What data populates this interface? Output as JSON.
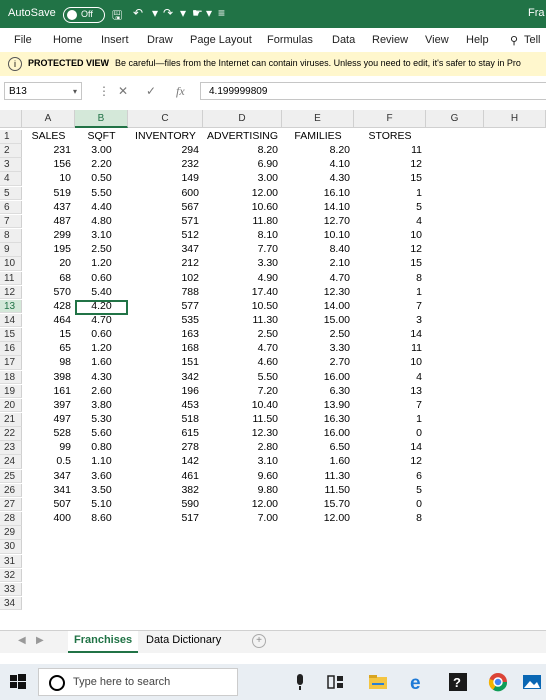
{
  "titlebar": {
    "autosave_label": "AutoSave",
    "autosave_state": "Off",
    "right_text": "Fra"
  },
  "ribbon": {
    "tabs": [
      "File",
      "Home",
      "Insert",
      "Draw",
      "Page Layout",
      "Formulas",
      "Data",
      "Review",
      "View",
      "Help",
      "Tell"
    ]
  },
  "protected": {
    "label": "PROTECTED VIEW",
    "message": "Be careful—files from the Internet can contain viruses. Unless you need to edit, it's safer to stay in Pro"
  },
  "formula_bar": {
    "name_box": "B13",
    "fx": "fx",
    "value": "4.199999809"
  },
  "columns": [
    "A",
    "B",
    "C",
    "D",
    "E",
    "F",
    "G",
    "H"
  ],
  "selected_column": "B",
  "selected_row": 13,
  "headers": [
    "SALES",
    "SQFT",
    "INVENTORY",
    "ADVERTISING",
    "FAMILIES",
    "STORES"
  ],
  "rows": [
    [
      "231",
      "3.00",
      "294",
      "8.20",
      "8.20",
      "11"
    ],
    [
      "156",
      "2.20",
      "232",
      "6.90",
      "4.10",
      "12"
    ],
    [
      "10",
      "0.50",
      "149",
      "3.00",
      "4.30",
      "15"
    ],
    [
      "519",
      "5.50",
      "600",
      "12.00",
      "16.10",
      "1"
    ],
    [
      "437",
      "4.40",
      "567",
      "10.60",
      "14.10",
      "5"
    ],
    [
      "487",
      "4.80",
      "571",
      "11.80",
      "12.70",
      "4"
    ],
    [
      "299",
      "3.10",
      "512",
      "8.10",
      "10.10",
      "10"
    ],
    [
      "195",
      "2.50",
      "347",
      "7.70",
      "8.40",
      "12"
    ],
    [
      "20",
      "1.20",
      "212",
      "3.30",
      "2.10",
      "15"
    ],
    [
      "68",
      "0.60",
      "102",
      "4.90",
      "4.70",
      "8"
    ],
    [
      "570",
      "5.40",
      "788",
      "17.40",
      "12.30",
      "1"
    ],
    [
      "428",
      "4.20",
      "577",
      "10.50",
      "14.00",
      "7"
    ],
    [
      "464",
      "4.70",
      "535",
      "11.30",
      "15.00",
      "3"
    ],
    [
      "15",
      "0.60",
      "163",
      "2.50",
      "2.50",
      "14"
    ],
    [
      "65",
      "1.20",
      "168",
      "4.70",
      "3.30",
      "11"
    ],
    [
      "98",
      "1.60",
      "151",
      "4.60",
      "2.70",
      "10"
    ],
    [
      "398",
      "4.30",
      "342",
      "5.50",
      "16.00",
      "4"
    ],
    [
      "161",
      "2.60",
      "196",
      "7.20",
      "6.30",
      "13"
    ],
    [
      "397",
      "3.80",
      "453",
      "10.40",
      "13.90",
      "7"
    ],
    [
      "497",
      "5.30",
      "518",
      "11.50",
      "16.30",
      "1"
    ],
    [
      "528",
      "5.60",
      "615",
      "12.30",
      "16.00",
      "0"
    ],
    [
      "99",
      "0.80",
      "278",
      "2.80",
      "6.50",
      "14"
    ],
    [
      "0.5",
      "1.10",
      "142",
      "3.10",
      "1.60",
      "12"
    ],
    [
      "347",
      "3.60",
      "461",
      "9.60",
      "11.30",
      "6"
    ],
    [
      "341",
      "3.50",
      "382",
      "9.80",
      "11.50",
      "5"
    ],
    [
      "507",
      "5.10",
      "590",
      "12.00",
      "15.70",
      "0"
    ],
    [
      "400",
      "8.60",
      "517",
      "7.00",
      "12.00",
      "8"
    ]
  ],
  "row_numbers": [
    "1",
    "2",
    "3",
    "4",
    "5",
    "6",
    "7",
    "8",
    "9",
    "10",
    "11",
    "12",
    "13",
    "14",
    "15",
    "16",
    "17",
    "18",
    "19",
    "20",
    "21",
    "22",
    "23",
    "24",
    "25",
    "26",
    "27",
    "28",
    "29",
    "30",
    "31",
    "32",
    "33",
    "34"
  ],
  "sheets": {
    "tabs": [
      "Franchises",
      "Data Dictionary"
    ],
    "active": "Franchises"
  },
  "taskbar": {
    "search_placeholder": "Type here to search"
  },
  "colors": {
    "excel_green": "#217346",
    "protected_bg": "#fff7cd"
  }
}
